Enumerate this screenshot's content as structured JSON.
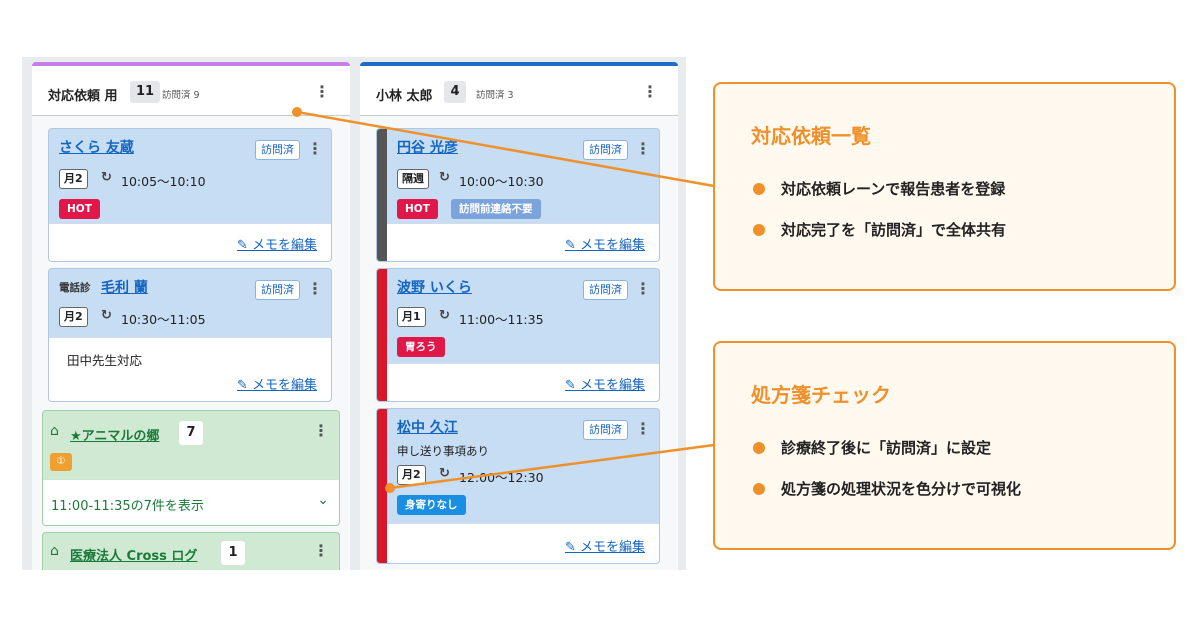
{
  "lane1": {
    "title": "対応依頼 用",
    "count": "11",
    "sub": "訪問済 9",
    "bar_color": "#c77ee6",
    "cards": [
      {
        "name": "さくら 友蔵",
        "visited": "訪問済",
        "freq": "月2",
        "time": "10:05〜10:10",
        "tag": "HOT",
        "memo_link": "メモを編集"
      },
      {
        "tel": "電話診",
        "name": "毛利 蘭",
        "visited": "訪問済",
        "freq": "月2",
        "time": "10:30〜11:05",
        "memo_note": "田中先生対応",
        "memo_link": "メモを編集"
      }
    ],
    "facilities": [
      {
        "name": "★アニマルの郷",
        "count": "7",
        "badge": "①",
        "show": "11:00-11:35の7件を表示"
      },
      {
        "name": "医療法人 Cross ログ",
        "count": "1"
      }
    ]
  },
  "lane2": {
    "title": "小林 太郎",
    "count": "4",
    "sub": "訪問済 3",
    "bar_color": "#1e6cc7",
    "cards": [
      {
        "name": "円谷 光彦",
        "visited": "訪問済",
        "freq": "隔週",
        "time": "10:00〜10:30",
        "tag": "HOT",
        "tag2": "訪問前連絡不要",
        "memo_link": "メモを編集",
        "stripe": "#555555"
      },
      {
        "name": "波野 いくら",
        "visited": "訪問済",
        "freq": "月1",
        "time": "11:00〜11:35",
        "tag": "胃ろう",
        "memo_link": "メモを編集",
        "stripe": "#d9162b"
      },
      {
        "name": "松中 久江",
        "visited": "訪問済",
        "note": "申し送り事項あり",
        "freq": "月2",
        "time": "12:00〜12:30",
        "tag": "身寄りなし",
        "memo_link": "メモを編集",
        "stripe": "#d9162b"
      }
    ]
  },
  "callout1": {
    "title": "対応依頼一覧",
    "bullets": [
      "対応依頼レーンで報告患者を登録",
      "対応完了を「訪問済」で全体共有"
    ]
  },
  "callout2": {
    "title": "処方箋チェック",
    "bullets": [
      "診療終了後に「訪問済」に設定",
      "処方箋の処理状況を色分けで可視化"
    ]
  },
  "colors": {
    "accent": "#f0902a",
    "link": "#1565c0",
    "hot": "#e0184a",
    "facility": "#cfe9d3",
    "card": "#c6ddf3"
  }
}
